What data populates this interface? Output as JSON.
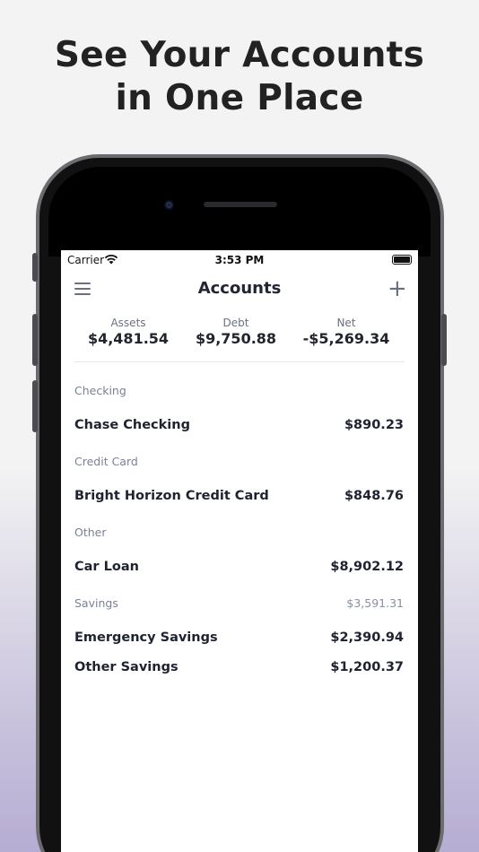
{
  "promo": {
    "line1": "See Your Accounts",
    "line2": "in One Place"
  },
  "status_bar": {
    "carrier": "Carrier",
    "time": "3:53 PM"
  },
  "navbar": {
    "title": "Accounts",
    "menu_icon": "hamburger-menu-icon",
    "add_icon": "plus-icon",
    "add_glyph": "+"
  },
  "summary": {
    "assets": {
      "label": "Assets",
      "value": "$4,481.54"
    },
    "debt": {
      "label": "Debt",
      "value": "$9,750.88"
    },
    "net": {
      "label": "Net",
      "value": "-$5,269.34"
    }
  },
  "sections": [
    {
      "label": "Checking",
      "total": "",
      "accounts": [
        {
          "name": "Chase Checking",
          "amount": "$890.23"
        }
      ]
    },
    {
      "label": "Credit Card",
      "total": "",
      "accounts": [
        {
          "name": "Bright Horizon Credit Card",
          "amount": "$848.76"
        }
      ]
    },
    {
      "label": "Other",
      "total": "",
      "accounts": [
        {
          "name": "Car Loan",
          "amount": "$8,902.12"
        }
      ]
    },
    {
      "label": "Savings",
      "total": "$3,591.31",
      "accounts": [
        {
          "name": "Emergency Savings",
          "amount": "$2,390.94"
        },
        {
          "name": "Other Savings",
          "amount": "$1,200.37"
        }
      ]
    }
  ],
  "colors": {
    "accent_gray": "#6a6f82",
    "text_dark": "#1f2230",
    "section_label": "#7a8296",
    "background_bottom": "#b6add3"
  }
}
